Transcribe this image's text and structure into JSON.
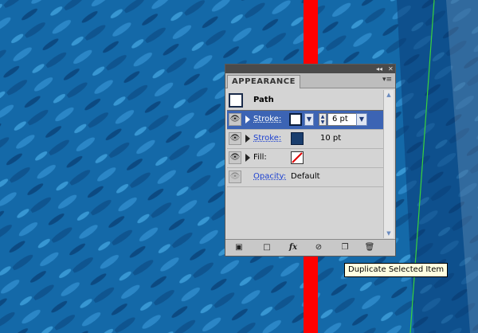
{
  "colors": {
    "canvas_bg": "#1469a8",
    "red_line": "#ff0000",
    "green_line": "#39d23c",
    "selection": "#3c64b4",
    "stroke_swatch": "#1a3e6e"
  },
  "panel": {
    "tab_label": "APPEARANCE",
    "object_type": "Path",
    "rows": [
      {
        "kind": "stroke",
        "label": "Stroke:",
        "weight_value": "6 pt",
        "selected": true
      },
      {
        "kind": "stroke",
        "label": "Stroke:",
        "weight_text": "10 pt",
        "selected": false
      },
      {
        "kind": "fill",
        "label": "Fill:",
        "selected": false
      },
      {
        "kind": "opacity",
        "label": "Opacity:",
        "value": "Default",
        "selected": false
      }
    ],
    "footer_icons": [
      "add-stroke-icon",
      "add-fill-icon",
      "fx-icon",
      "clear-appearance-icon",
      "duplicate-item-icon",
      "delete-item-icon"
    ]
  },
  "tooltip": {
    "text": "Duplicate Selected Item"
  }
}
